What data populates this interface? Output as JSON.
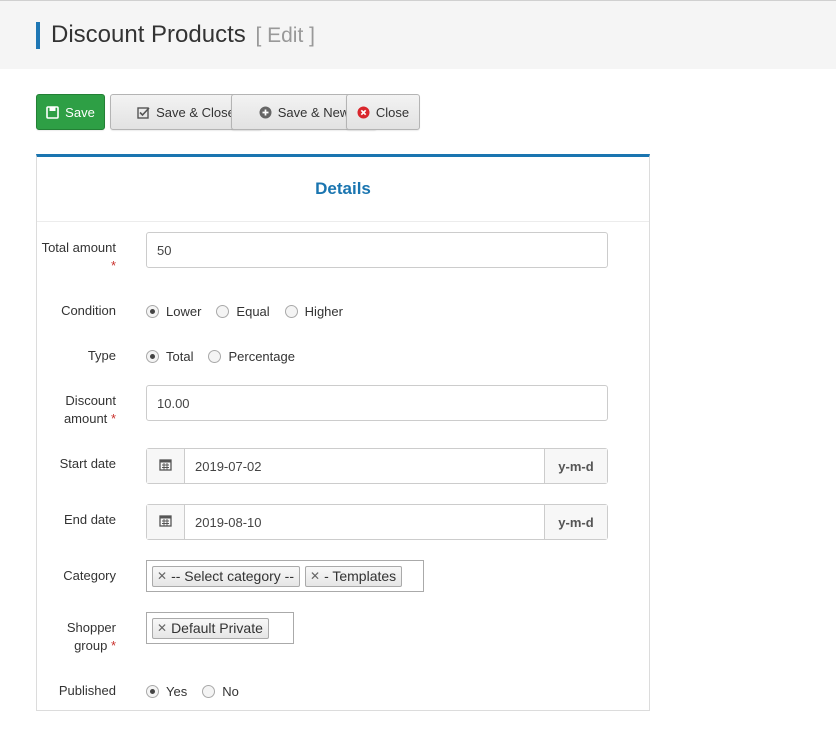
{
  "header": {
    "title": "Discount Products",
    "subtitle": "[ Edit ]"
  },
  "toolbar": {
    "save": "Save",
    "save_close": "Save & Close",
    "save_new": "Save & New",
    "close": "Close"
  },
  "panel": {
    "heading": "Details"
  },
  "form": {
    "total_amount": {
      "label": "Total amount",
      "required_mark": "*",
      "value": "50"
    },
    "condition": {
      "label": "Condition",
      "options": [
        "Lower",
        "Equal",
        "Higher"
      ],
      "selected": "Lower"
    },
    "type": {
      "label": "Type",
      "options": [
        "Total",
        "Percentage"
      ],
      "selected": "Total"
    },
    "discount_amount": {
      "label": "Discount amount",
      "required_mark": "*",
      "value": "10.00"
    },
    "start_date": {
      "label": "Start date",
      "value": "2019-07-02",
      "format": "y-m-d"
    },
    "end_date": {
      "label": "End date",
      "value": "2019-08-10",
      "format": "y-m-d"
    },
    "category": {
      "label": "Category",
      "tags": [
        "-- Select category --",
        "- Templates"
      ]
    },
    "shopper_group": {
      "label": "Shopper group",
      "required_mark": "*",
      "tags": [
        "Default Private"
      ]
    },
    "published": {
      "label": "Published",
      "options": [
        "Yes",
        "No"
      ],
      "selected": "Yes"
    }
  },
  "colors": {
    "accent": "#1a75b0",
    "primary_button": "#2e9f45",
    "close_icon": "#d9262c",
    "required": "#c9302c"
  },
  "icons": {
    "save": "floppy-disk-icon",
    "save_close": "checkbox-icon",
    "save_new": "plus-circle-icon",
    "close": "x-circle-icon",
    "calendar": "calendar-icon",
    "tag_remove": "remove-x-icon"
  }
}
